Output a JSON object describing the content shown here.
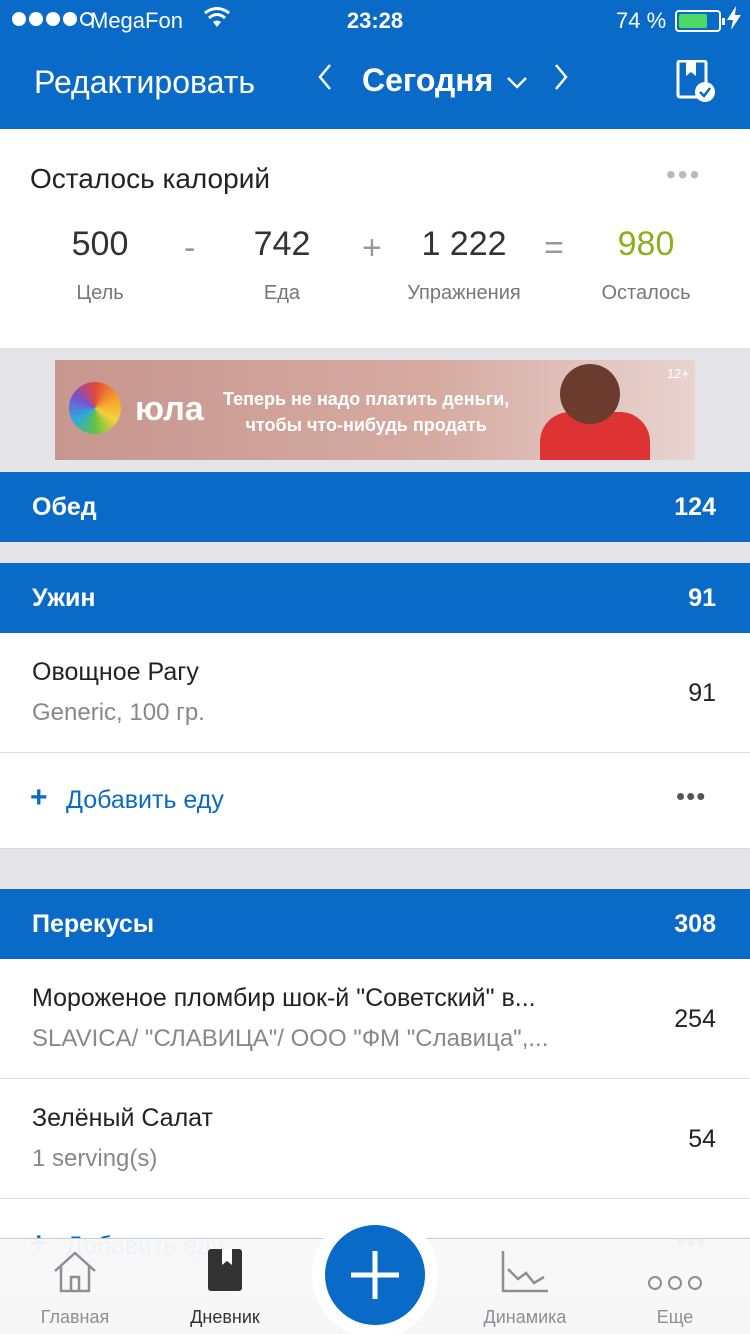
{
  "status_bar": {
    "carrier": "MegaFon",
    "time": "23:28",
    "battery_pct": "74 %",
    "battery_level": 0.74
  },
  "nav": {
    "edit_label": "Редактировать",
    "title": "Сегодня",
    "prev": "‹",
    "next": "›"
  },
  "calories": {
    "title": "Осталось калорий",
    "more": "•••",
    "goal": {
      "value": "500",
      "label": "Цель"
    },
    "food": {
      "value": "742",
      "label": "Еда"
    },
    "exercise": {
      "value": "1 222",
      "label": "Упражнения"
    },
    "remaining": {
      "value": "980",
      "label": "Осталось"
    },
    "op_minus": "-",
    "op_plus": "+",
    "op_equals": "=",
    "remaining_color": "#8ab01e"
  },
  "ad": {
    "brand": "юла",
    "text_line1": "Теперь не надо платить деньги,",
    "text_line2": "чтобы что-нибудь продать",
    "age": "12+"
  },
  "meals": {
    "lunch": {
      "name": "Обед",
      "calories": "124"
    },
    "dinner": {
      "name": "Ужин",
      "calories": "91",
      "items": [
        {
          "name": "Овощное Рагу",
          "detail": "Generic, 100 гр.",
          "calories": "91"
        }
      ],
      "add_label": "Добавить еду"
    },
    "snacks": {
      "name": "Перекусы",
      "calories": "308",
      "items": [
        {
          "name": "Мороженое пломбир шок-й \"Советский\" в...",
          "detail": "SLAVICA/ \"СЛАВИЦА\"/ ООО \"ФМ \"Славица\",...",
          "calories": "254"
        },
        {
          "name": "Зелёный Салат",
          "detail": "1 serving(s)",
          "calories": "54"
        }
      ]
    }
  },
  "tabbar": {
    "home": "Главная",
    "diary": "Дневник",
    "progress": "Динамика",
    "more": "Еще"
  },
  "accent_color": "#0a6ac7"
}
